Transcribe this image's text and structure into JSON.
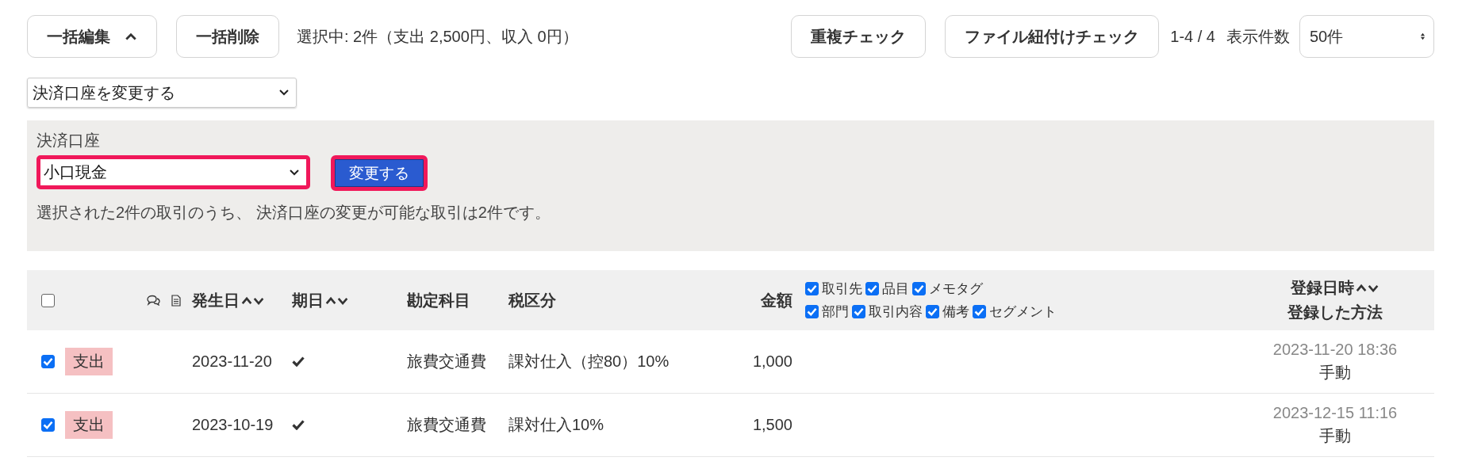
{
  "toolbar": {
    "bulk_edit": {
      "label": "一括編集",
      "expanded": true
    },
    "bulk_delete": "一括削除",
    "selection_summary": "選択中: 2件（支出 2,500円、収入 0円）",
    "duplicate_check": "重複チェック",
    "file_link_check": "ファイル紐付けチェック",
    "range": "1-4 / 4",
    "per_page_label": "表示件数",
    "per_page": "50件"
  },
  "action_select": "決済口座を変更する",
  "panel": {
    "label": "決済口座",
    "account": "小口現金",
    "submit": "変更する",
    "note": "選択された2件の取引のうち、 決済口座の変更が可能な取引は2件です。"
  },
  "table": {
    "select_all": false,
    "columns": [
      {
        "label": "発生日",
        "sortable": true
      },
      {
        "label": "期日",
        "sortable": true
      },
      {
        "label": "勘定科目",
        "sortable": false
      },
      {
        "label": "税区分",
        "sortable": false
      },
      {
        "label": "金額",
        "sortable": false
      }
    ],
    "display_option_rows": [
      [
        {
          "label": "取引先",
          "checked": true
        },
        {
          "label": "品目",
          "checked": true
        },
        {
          "label": "メモタグ",
          "checked": true
        }
      ],
      [
        {
          "label": "部門",
          "checked": true
        },
        {
          "label": "取引内容",
          "checked": true
        },
        {
          "label": "備考",
          "checked": true
        },
        {
          "label": "セグメント",
          "checked": true
        }
      ]
    ],
    "registered_header": {
      "label": "登録日時",
      "sortable": true
    },
    "method_header": "登録した方法",
    "rows": [
      {
        "checked": true,
        "type": "支出",
        "kind": "expense",
        "date": "2023-11-20",
        "due_settled": true,
        "account": "旅費交通費",
        "tax": "課対仕入（控80）10%",
        "amount": "1,000",
        "registered": "2023-11-20 18:36",
        "method": "手動"
      },
      {
        "checked": true,
        "type": "支出",
        "kind": "expense",
        "date": "2023-10-19",
        "due_settled": true,
        "account": "旅費交通費",
        "tax": "課対仕入10%",
        "amount": "1,500",
        "registered": "2023-12-15 11:16",
        "method": "手動"
      }
    ]
  }
}
